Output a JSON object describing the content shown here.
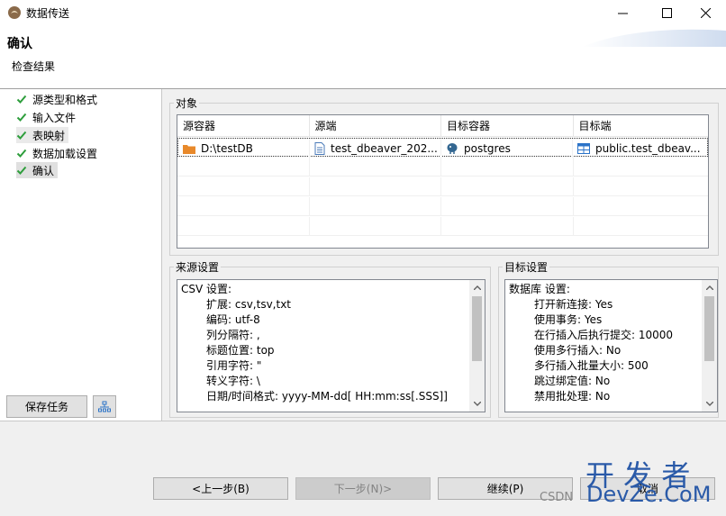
{
  "window": {
    "title": "数据传送"
  },
  "header": {
    "title": "确认",
    "subtitle": "检查结果"
  },
  "steps": [
    {
      "label": "源类型和格式"
    },
    {
      "label": "输入文件"
    },
    {
      "label": "表映射"
    },
    {
      "label": "数据加载设置"
    },
    {
      "label": "确认"
    }
  ],
  "sidebar": {
    "save_task": "保存任务"
  },
  "objects": {
    "group_label": "对象",
    "columns": [
      "源容器",
      "源端",
      "目标容器",
      "目标端"
    ],
    "rows": [
      {
        "source_container": "D:\\testDB",
        "source": "test_dbeaver_202...",
        "target_container": "postgres",
        "target": "public.test_dbeav..."
      }
    ]
  },
  "source_settings": {
    "group_label": "来源设置",
    "heading": "CSV 设置:",
    "lines": [
      "扩展: csv,tsv,txt",
      "编码: utf-8",
      "列分隔符: ,",
      "标题位置: top",
      "引用字符: \"",
      "转义字符: \\",
      "日期/时间格式: yyyy-MM-dd[ HH:mm:ss[.SSS]]"
    ]
  },
  "target_settings": {
    "group_label": "目标设置",
    "heading": "数据库 设置:",
    "lines": [
      "打开新连接: Yes",
      "使用事务: Yes",
      "在行插入后执行提交: 10000",
      "使用多行插入: No",
      "多行插入批量大小: 500",
      "跳过绑定值: No",
      "禁用批处理: No"
    ]
  },
  "nav": {
    "back": "<上一步(B)",
    "next": "下一步(N)>",
    "proceed": "继续(P)",
    "cancel": "取消"
  },
  "watermark": {
    "csdn": "CSDN",
    "brand_cn": "开 发 者",
    "brand_en": "DevZe.CoM"
  },
  "colors": {
    "check": "#2e9e3c",
    "folder": "#e8892b",
    "table_icon": "#2b73c8"
  }
}
